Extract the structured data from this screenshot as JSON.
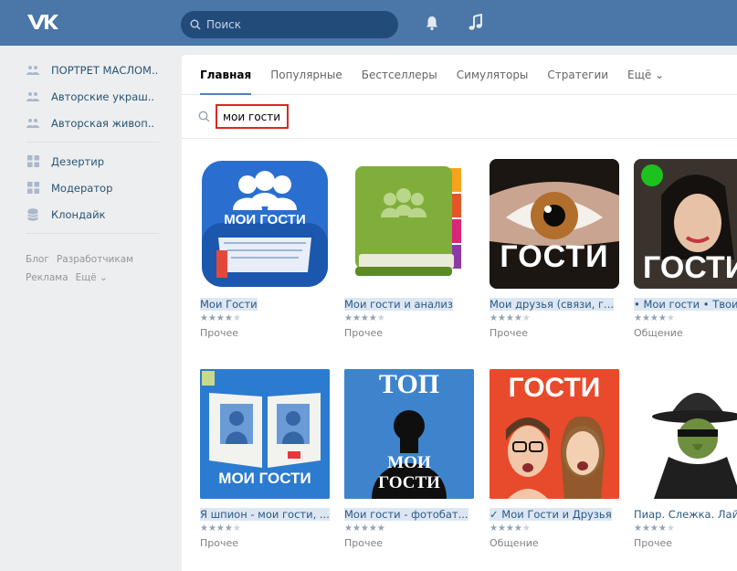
{
  "header": {
    "logo": "ВК",
    "search_placeholder": "Поиск"
  },
  "sidebar": {
    "groups": [
      {
        "label": "ПОРТРЕТ МАСЛОМ..",
        "icon": "group-icon"
      },
      {
        "label": "Авторские украш..",
        "icon": "group-icon"
      },
      {
        "label": "Авторская живоп..",
        "icon": "group-icon"
      }
    ],
    "apps": [
      {
        "label": "Дезертир",
        "icon": "app-grid-icon"
      },
      {
        "label": "Модератор",
        "icon": "app-grid-icon"
      },
      {
        "label": "Клондайк",
        "icon": "database-icon"
      }
    ],
    "footer": [
      "Блог",
      "Разработчикам",
      "Реклама",
      "Ещё ⌄"
    ]
  },
  "tabs": [
    {
      "label": "Главная",
      "active": true
    },
    {
      "label": "Популярные"
    },
    {
      "label": "Бестселлеры"
    },
    {
      "label": "Симуляторы"
    },
    {
      "label": "Стратегии"
    },
    {
      "label": "Ещё ⌄"
    }
  ],
  "search": {
    "value": "мои гости"
  },
  "cards": [
    {
      "title": "Мои Гости",
      "rating": 4,
      "category": "Прочее"
    },
    {
      "title": "Мои гости и анализ",
      "rating": 4,
      "category": "Прочее"
    },
    {
      "title": "Мои друзья (связи, г...",
      "rating": 4,
      "category": "Прочее"
    },
    {
      "title": "• Мои гости • Твои...",
      "rating": 4,
      "category": "Общение"
    },
    {
      "title": "Я шпион - мои гости, ...",
      "rating": 4,
      "category": "Прочее"
    },
    {
      "title": "Мои гости - фотобат...",
      "rating": 5,
      "category": "Прочее"
    },
    {
      "title": "✓ Мои Гости и Друзья",
      "rating": 4,
      "category": "Общение"
    },
    {
      "title": "Пиар. Слежка. Лай...",
      "rating": 4,
      "category": "Прочее"
    }
  ],
  "thumb_text": {
    "c1": "МОИ ГОСТИ",
    "c3": "ГОСТИ",
    "c4": "ГОСТИ",
    "c5": "МОИ ГОСТИ",
    "c6_top": "ТОП",
    "c6_mid": "МОИ",
    "c6_bot": "ГОСТИ",
    "c7": "ГОСТИ"
  }
}
